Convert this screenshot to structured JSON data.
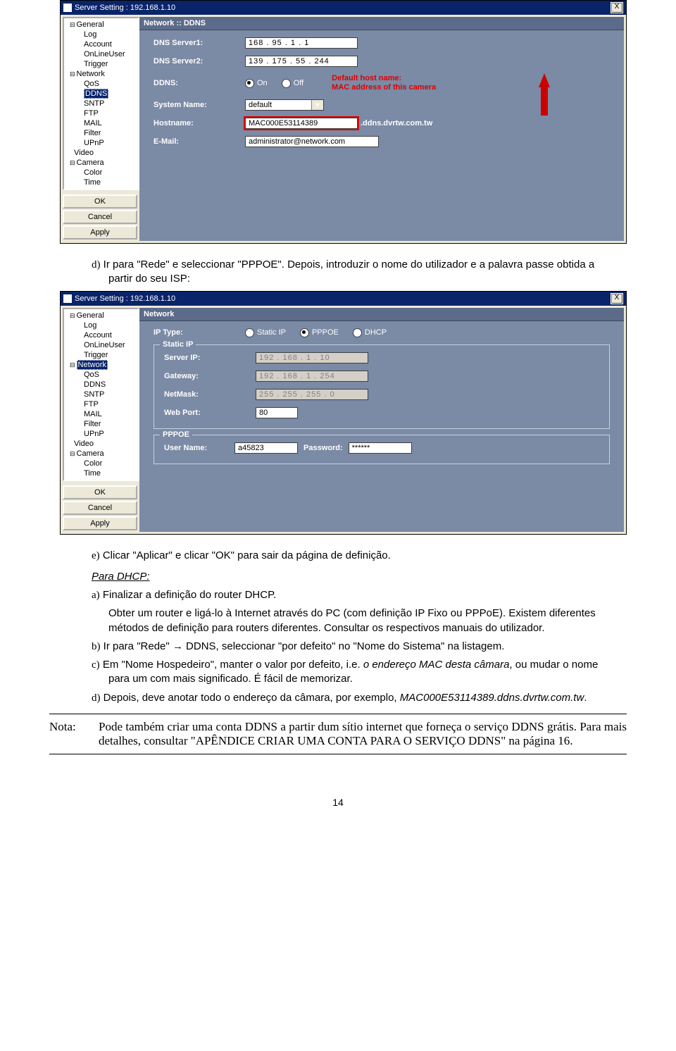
{
  "win_title": "Server Setting : 192.168.1.10",
  "close_x": "X",
  "tree1": {
    "general": "General",
    "log": "Log",
    "account": "Account",
    "online": "OnLineUser",
    "trigger": "Trigger",
    "network": "Network",
    "qos": "QoS",
    "ddns": "DDNS",
    "sntp": "SNTP",
    "ftp": "FTP",
    "mail": "MAIL",
    "filter": "Filter",
    "upnp": "UPnP",
    "video": "Video",
    "camera": "Camera",
    "color": "Color",
    "time": "Time"
  },
  "buttons": {
    "ok": "OK",
    "cancel": "Cancel",
    "apply": "Apply"
  },
  "panel1": {
    "header": "Network :: DDNS",
    "dns1_lbl": "DNS Server1:",
    "dns1_val": "168 .  95 .   1 .   1",
    "dns2_lbl": "DNS Server2:",
    "dns2_val": "139 . 175 .  55 . 244",
    "ddns_lbl": "DDNS:",
    "on": "On",
    "off": "Off",
    "note_l1": "Default host name:",
    "note_l2": "MAC address of this camera",
    "sysname_lbl": "System Name:",
    "sysname_val": "default",
    "host_lbl": "Hostname:",
    "host_val": "MAC000E53114389",
    "suffix": ".ddns.dvrtw.com.tw",
    "email_lbl": "E-Mail:",
    "email_val": "administrator@network.com"
  },
  "panel2": {
    "header": "Network",
    "iptype_lbl": "IP Type:",
    "r_static": "Static IP",
    "r_pppoe": "PPPOE",
    "r_dhcp": "DHCP",
    "fs_static": "Static IP",
    "srvip_lbl": "Server IP:",
    "srvip_val": "192 . 168 .   1 .  10",
    "gw_lbl": "Gateway:",
    "gw_val": "192 . 168 .   1 . 254",
    "mask_lbl": "NetMask:",
    "mask_val": "255 . 255 . 255 .   0",
    "port_lbl": "Web Port:",
    "port_val": "80",
    "fs_pppoe": "PPPOE",
    "user_lbl": "User Name:",
    "user_val": "a45823",
    "pass_lbl": "Password:",
    "pass_val": "******"
  },
  "text": {
    "d_intro": "Ir para \"Rede\" e seleccionar \"PPPOE\". Depois, introduzir o nome do utilizador e a palavra passe obtida a partir do seu ISP:",
    "e_line": "Clicar \"Aplicar\" e clicar \"OK\" para sair da página de definição.",
    "para_dhcp": "Para DHCP:",
    "a_l1": "Finalizar a definição do router DHCP.",
    "a_l2": "Obter um router e ligá-lo à Internet através do PC (com definição IP Fixo ou PPPoE). Existem diferentes métodos de definição para routers diferentes. Consultar os respectivos manuais do utilizador.",
    "b_line": "Ir para \"Rede\" → DDNS, seleccionar \"por defeito\" no \"Nome do Sistema\" na listagem.",
    "c_line": "Em \"Nome Hospedeiro\", manter o valor por defeito, i.e. o endereço MAC desta câmara, ou mudar o nome para um com mais significado. É fácil de memorizar.",
    "d_line": "Depois, deve anotar todo o endereço da câmara, por exemplo, MAC000E53114389.ddns.dvrtw.com.tw.",
    "nota_label": "Nota:",
    "nota_body": "Pode também criar uma conta DDNS a partir dum sítio internet que forneça o serviço DDNS grátis. Para mais detalhes, consultar \"APÊNDICE CRIAR UMA CONTA PARA O SERVIÇO DDNS\" na página 16."
  },
  "markers": {
    "d": "d)",
    "e": "e)",
    "a": "a)",
    "b": "b)",
    "c": "c)",
    "d2": "d)"
  },
  "pagenum": "14"
}
